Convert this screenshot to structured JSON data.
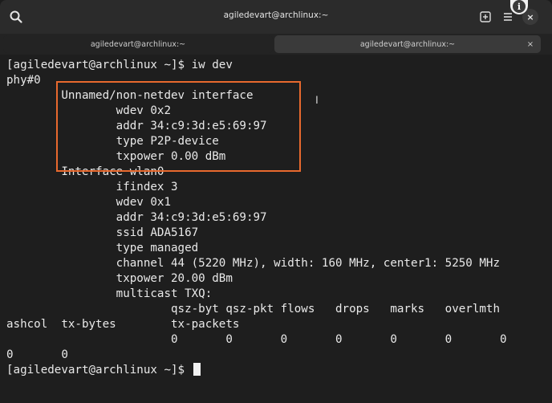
{
  "window": {
    "title": "agiledevart@archlinux:~",
    "close_label": "×",
    "info_label": "i"
  },
  "tabs": [
    {
      "label": "agiledevart@archlinux:~",
      "active": true
    },
    {
      "label": "agiledevart@archlinux:~",
      "active": false,
      "close_label": "×"
    }
  ],
  "terminal": {
    "lines": [
      "[agiledevart@archlinux ~]$ iw dev",
      "phy#0",
      "        Unnamed/non-netdev interface",
      "                wdev 0x2",
      "                addr 34:c9:3d:e5:69:97",
      "                type P2P-device",
      "                txpower 0.00 dBm",
      "        Interface wlan0",
      "                ifindex 3",
      "                wdev 0x1",
      "                addr 34:c9:3d:e5:69:97",
      "                ssid ADA5167",
      "                type managed",
      "                channel 44 (5220 MHz), width: 160 MHz, center1: 5250 MHz",
      "                txpower 20.00 dBm",
      "                multicast TXQ:",
      "                        qsz-byt qsz-pkt flows   drops   marks   overlmth",
      "ashcol  tx-bytes        tx-packets",
      "                        0       0       0       0       0       0       0",
      "0       0",
      "[agiledevart@archlinux ~]$ "
    ]
  },
  "colors": {
    "highlight": "#e8692e",
    "background": "#1e1e1e",
    "text": "#e9e9e9"
  }
}
